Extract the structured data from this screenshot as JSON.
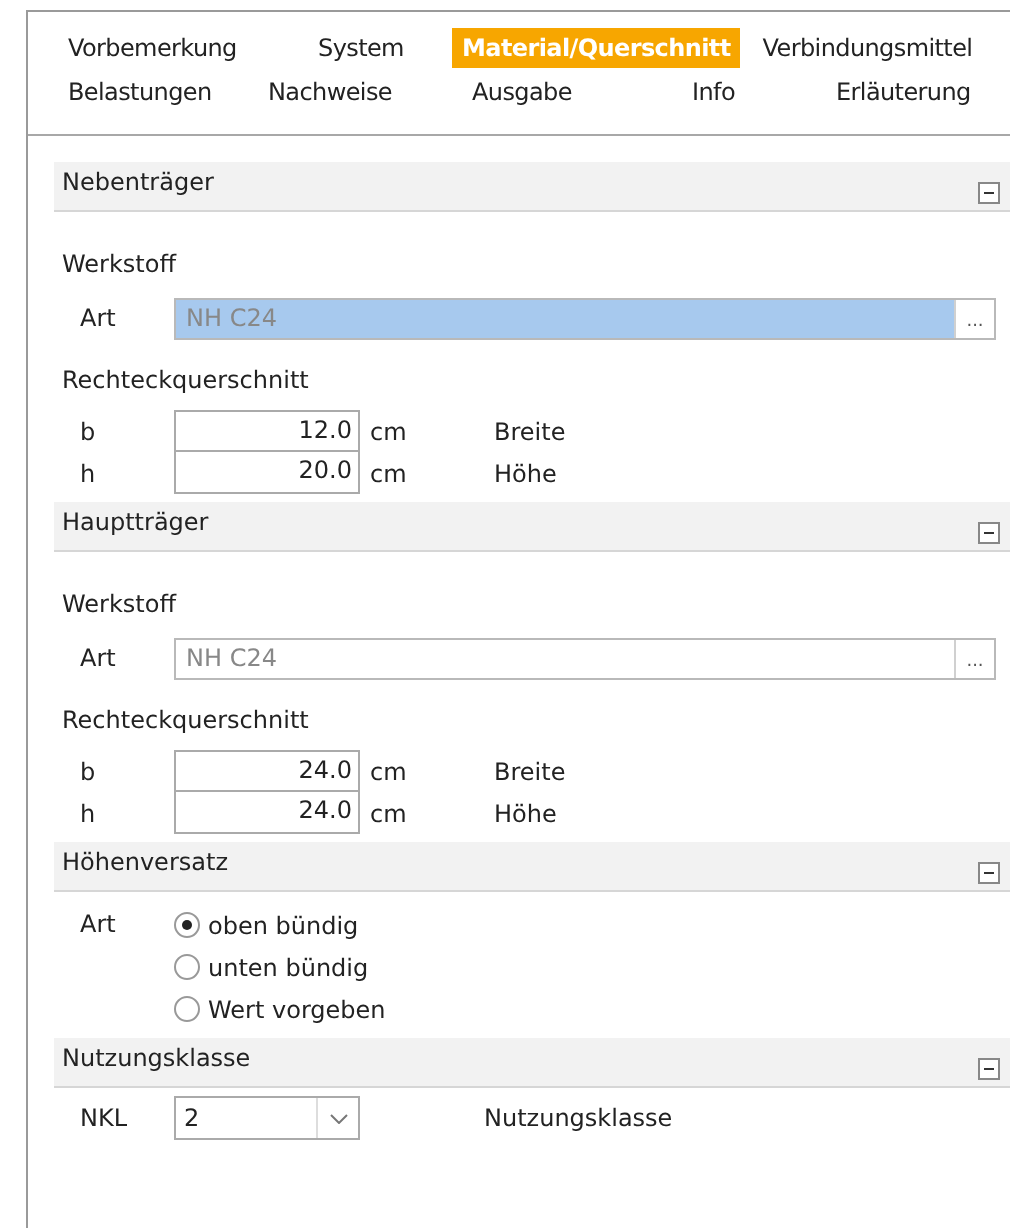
{
  "tabs": [
    [
      {
        "label": "Vorbemerkung",
        "selected": false
      },
      {
        "label": "System",
        "selected": false
      },
      {
        "label": "Material/Querschnitt",
        "selected": true
      },
      {
        "label": "Verbindungsmittel",
        "selected": false
      }
    ],
    [
      {
        "label": "Belastungen",
        "selected": false
      },
      {
        "label": "Nachweise",
        "selected": false
      },
      {
        "label": "Ausgabe",
        "selected": false
      },
      {
        "label": "Info",
        "selected": false
      },
      {
        "label": "Erläuterung",
        "selected": false
      }
    ]
  ],
  "sections": [
    {
      "title": "Nebenträger",
      "expanded": true,
      "items": [
        {
          "kind": "group",
          "label": "Werkstoff"
        },
        {
          "kind": "material",
          "label": "Art",
          "value": "NH C24",
          "selected": true,
          "button": "..."
        },
        {
          "kind": "group",
          "label": "Rechteckquerschnitt"
        },
        {
          "kind": "dimension",
          "label": "b",
          "value": "12.0",
          "unit": "cm",
          "description": "Breite"
        },
        {
          "kind": "dimension",
          "label": "h",
          "value": "20.0",
          "unit": "cm",
          "description": "Höhe"
        }
      ]
    },
    {
      "title": "Hauptträger",
      "expanded": true,
      "items": [
        {
          "kind": "group",
          "label": "Werkstoff"
        },
        {
          "kind": "material",
          "label": "Art",
          "value": "NH C24",
          "selected": false,
          "button": "..."
        },
        {
          "kind": "group",
          "label": "Rechteckquerschnitt"
        },
        {
          "kind": "dimension",
          "label": "b",
          "value": "24.0",
          "unit": "cm",
          "description": "Breite"
        },
        {
          "kind": "dimension",
          "label": "h",
          "value": "24.0",
          "unit": "cm",
          "description": "Höhe"
        }
      ]
    },
    {
      "title": "Höhenversatz",
      "expanded": true,
      "items": [
        {
          "kind": "radio",
          "label": "Art",
          "options": [
            {
              "label": "oben bündig",
              "selected": true
            },
            {
              "label": "unten bündig",
              "selected": false
            },
            {
              "label": "Wert vorgeben",
              "selected": false
            }
          ]
        }
      ]
    },
    {
      "title": "Nutzungsklasse",
      "expanded": true,
      "items": [
        {
          "kind": "select",
          "label": "NKL",
          "value": "2",
          "description": "Nutzungsklasse"
        }
      ]
    }
  ]
}
